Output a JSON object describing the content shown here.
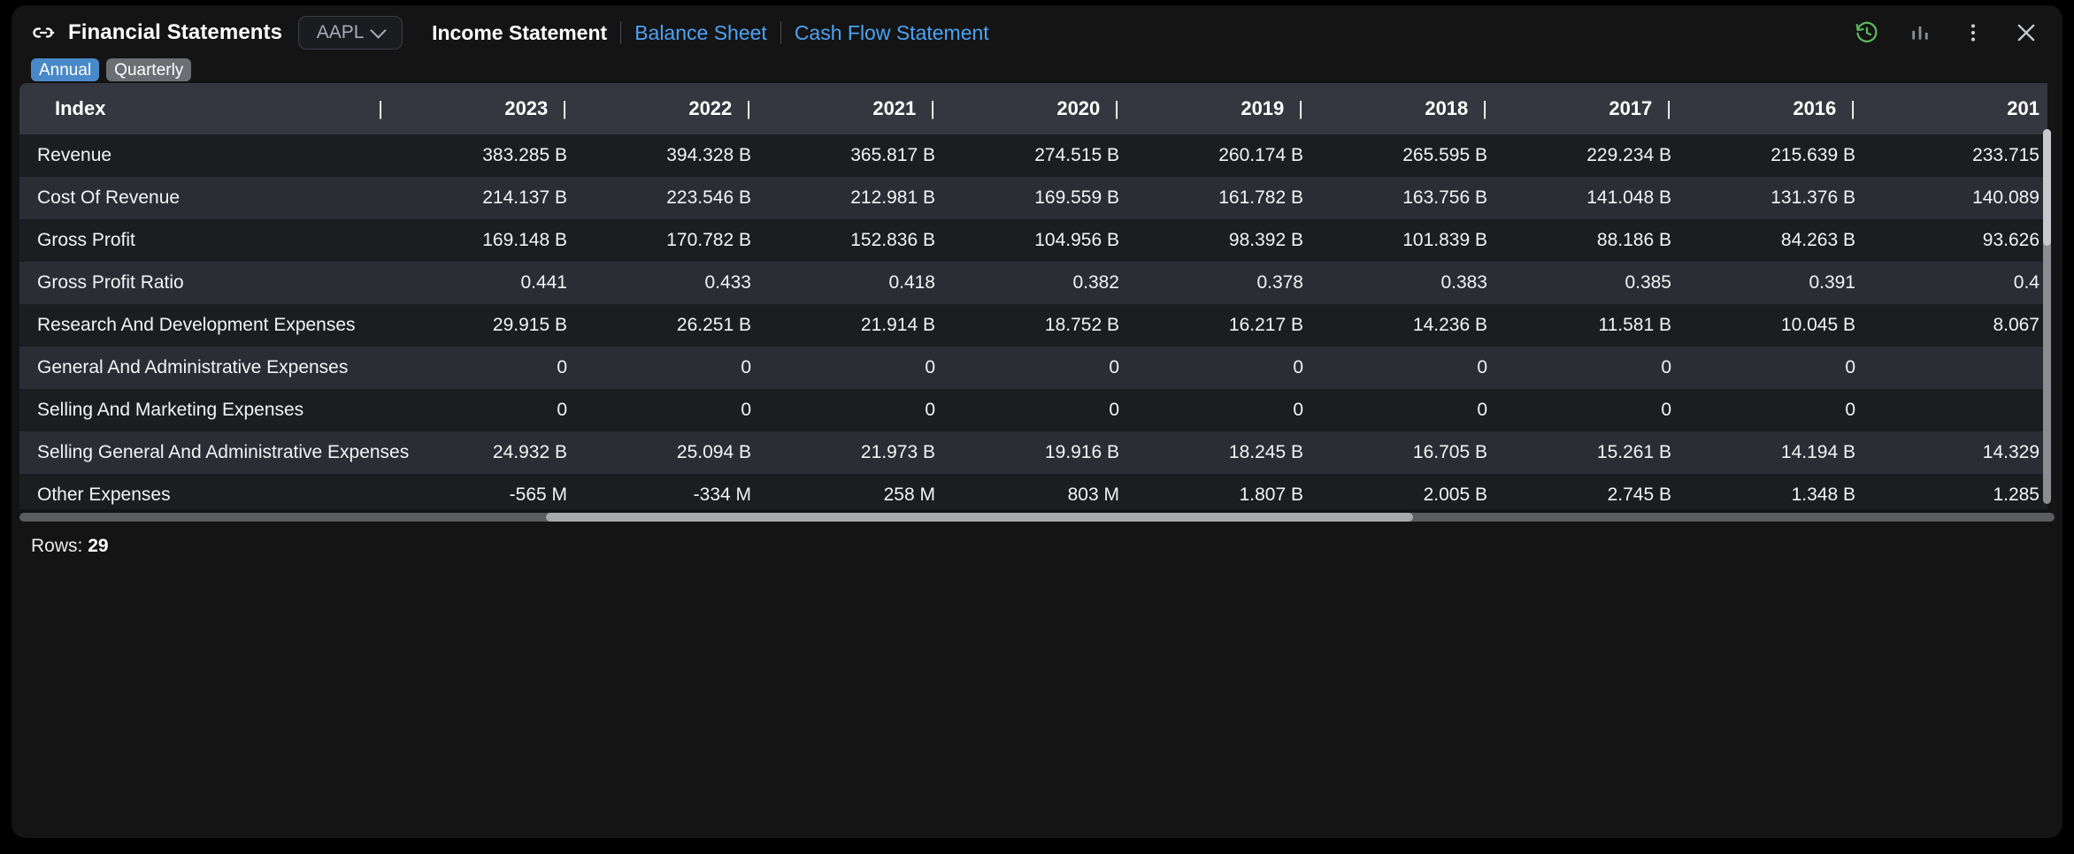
{
  "header": {
    "link_icon": "link-icon",
    "app_title": "Financial Statements",
    "ticker": "AAPL",
    "nav": [
      {
        "label": "Income Statement",
        "active": true
      },
      {
        "label": "Balance Sheet",
        "active": false
      },
      {
        "label": "Cash Flow Statement",
        "active": false
      }
    ],
    "actions": [
      {
        "name": "history-icon",
        "color": "#5cb85c"
      },
      {
        "name": "bar-chart-icon",
        "color": "#8b8f96"
      },
      {
        "name": "more-vertical-icon",
        "color": "#c9ccd1"
      },
      {
        "name": "close-icon",
        "color": "#c9ccd1"
      }
    ]
  },
  "period_toggle": {
    "options": [
      "Annual",
      "Quarterly"
    ],
    "selected": "Annual"
  },
  "table": {
    "columns": [
      "Index",
      "2023",
      "2022",
      "2021",
      "2020",
      "2019",
      "2018",
      "2017",
      "2016",
      "201"
    ],
    "separator": "|",
    "rows": [
      {
        "index": "Revenue",
        "values": [
          "383.285 B",
          "394.328 B",
          "365.817 B",
          "274.515 B",
          "260.174 B",
          "265.595 B",
          "229.234 B",
          "215.639 B",
          "233.715"
        ]
      },
      {
        "index": "Cost Of Revenue",
        "values": [
          "214.137 B",
          "223.546 B",
          "212.981 B",
          "169.559 B",
          "161.782 B",
          "163.756 B",
          "141.048 B",
          "131.376 B",
          "140.089"
        ]
      },
      {
        "index": "Gross Profit",
        "values": [
          "169.148 B",
          "170.782 B",
          "152.836 B",
          "104.956 B",
          "98.392 B",
          "101.839 B",
          "88.186 B",
          "84.263 B",
          "93.626"
        ]
      },
      {
        "index": "Gross Profit Ratio",
        "values": [
          "0.441",
          "0.433",
          "0.418",
          "0.382",
          "0.378",
          "0.383",
          "0.385",
          "0.391",
          "0.4"
        ]
      },
      {
        "index": "Research And Development Expenses",
        "values": [
          "29.915 B",
          "26.251 B",
          "21.914 B",
          "18.752 B",
          "16.217 B",
          "14.236 B",
          "11.581 B",
          "10.045 B",
          "8.067"
        ]
      },
      {
        "index": "General And Administrative Expenses",
        "values": [
          "0",
          "0",
          "0",
          "0",
          "0",
          "0",
          "0",
          "0",
          ""
        ]
      },
      {
        "index": "Selling And Marketing Expenses",
        "values": [
          "0",
          "0",
          "0",
          "0",
          "0",
          "0",
          "0",
          "0",
          ""
        ]
      },
      {
        "index": "Selling General And Administrative Expenses",
        "values": [
          "24.932 B",
          "25.094 B",
          "21.973 B",
          "19.916 B",
          "18.245 B",
          "16.705 B",
          "15.261 B",
          "14.194 B",
          "14.329"
        ]
      },
      {
        "index": "Other Expenses",
        "values": [
          "-565 M",
          "-334 M",
          "258 M",
          "803 M",
          "1.807 B",
          "2.005 B",
          "2.745 B",
          "1.348 B",
          "1.285"
        ]
      }
    ]
  },
  "footer": {
    "rows_label": "Rows:",
    "rows_count": "29"
  },
  "colors": {
    "panel_bg": "#141414",
    "header_row_bg": "#34373f",
    "row_odd_bg": "#1c1d21",
    "row_even_bg": "#2a2d34",
    "link_blue": "#4da3f5",
    "pill_active": "#4a89c8",
    "pill_inactive": "#6b6e73",
    "history_green": "#5cb85c"
  }
}
